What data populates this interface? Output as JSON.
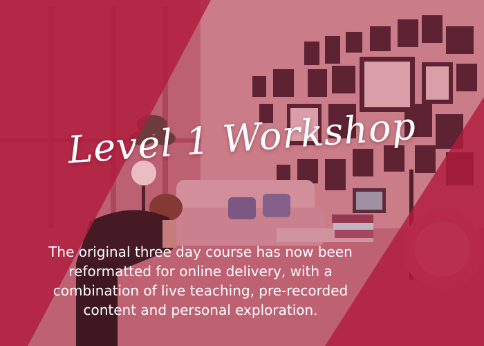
{
  "title": "Level 1 Workshop",
  "body_lines": [
    "The original three day course has now been",
    "reformatted for online delivery, with a",
    "combination of live teaching, pre-recorded",
    "content and personal exploration."
  ],
  "colors": {
    "overlay_dark": "#b0163b",
    "overlay_light": "#c8707f",
    "text": "#ffffff"
  }
}
